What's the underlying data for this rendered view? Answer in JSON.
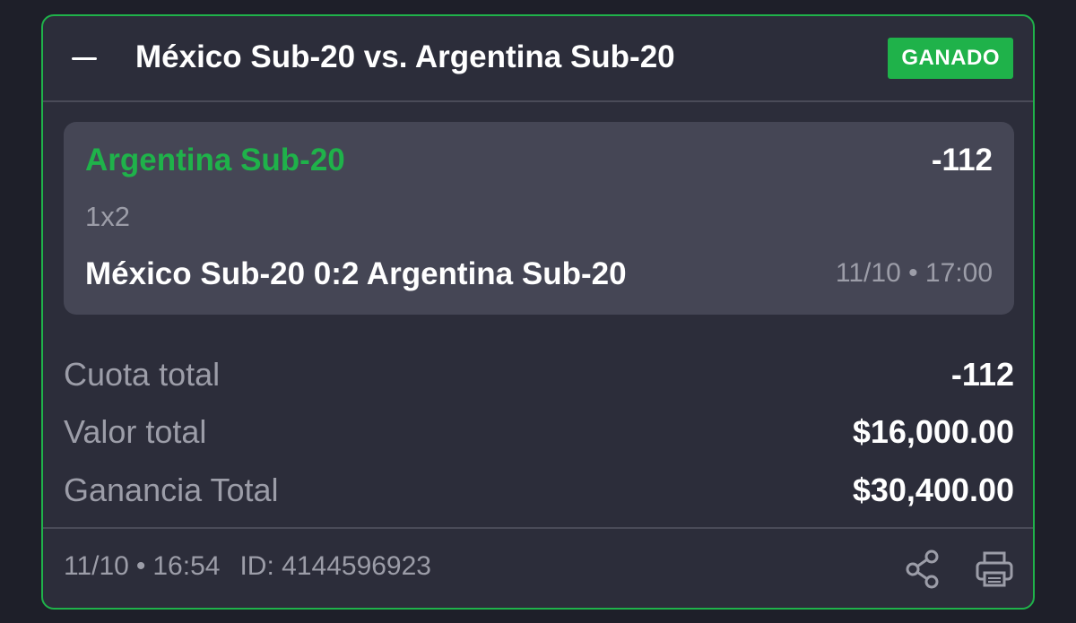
{
  "header": {
    "collapse_icon": "minus-icon",
    "title": "México Sub-20 vs. Argentina Sub-20",
    "status": "GANADO"
  },
  "selection": {
    "team": "Argentina Sub-20",
    "odds": "-112",
    "market": "1x2",
    "result": "México Sub-20 0:2 Argentina Sub-20",
    "datetime": "11/10 • 17:00"
  },
  "totals": [
    {
      "label": "Cuota total",
      "value": "-112"
    },
    {
      "label": "Valor total",
      "value": "$16,000.00"
    },
    {
      "label": "Ganancia Total",
      "value": "$30,400.00"
    }
  ],
  "footer": {
    "date": "11/10",
    "separator": "•",
    "time": "16:54",
    "id_label": "ID:",
    "id_value": "4144596923",
    "share_icon": "share-icon",
    "print_icon": "print-icon"
  },
  "colors": {
    "background": "#1e1f29",
    "card": "#2c2d3a",
    "accent_green": "#1fb24a",
    "selection_bg": "#454655",
    "muted_text": "#9c9da8"
  }
}
